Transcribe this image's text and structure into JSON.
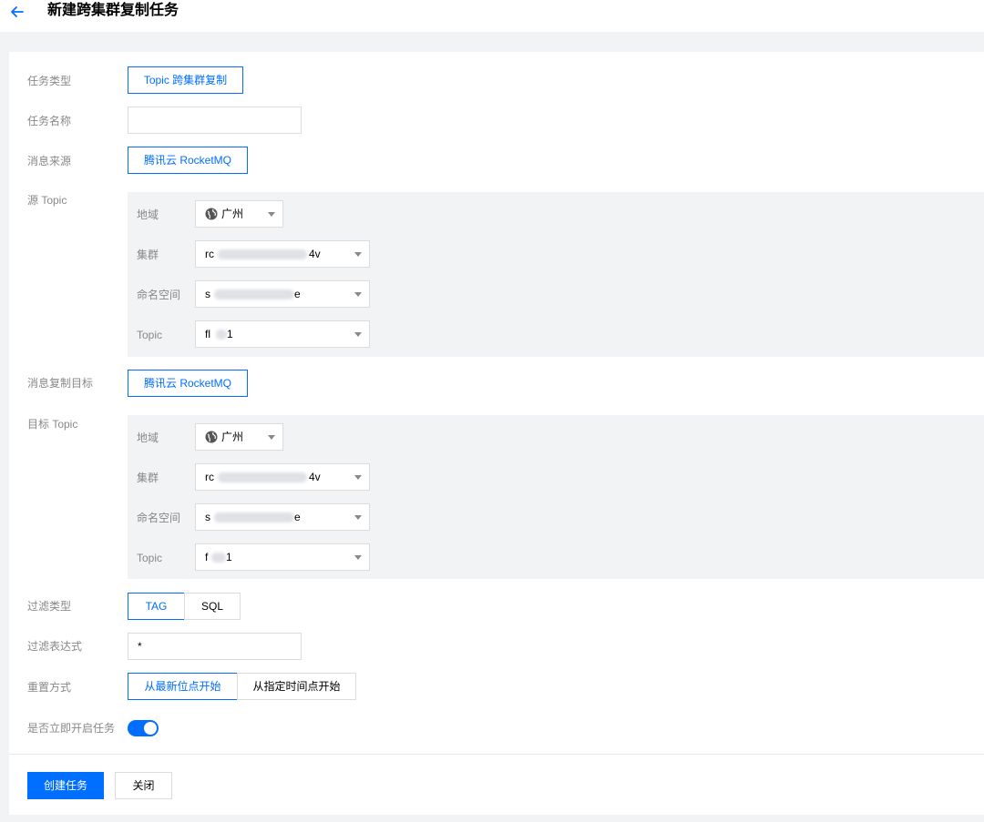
{
  "header": {
    "back_icon": "arrow-left-icon",
    "title": "新建跨集群复制任务"
  },
  "form": {
    "task_type": {
      "label": "任务类型",
      "value": "Topic 跨集群复制"
    },
    "task_name": {
      "label": "任务名称",
      "value": "",
      "placeholder": ""
    },
    "message_source": {
      "label": "消息来源",
      "value": "腾讯云 RocketMQ"
    },
    "source_topic": {
      "label": "源 Topic",
      "region": {
        "label": "地域",
        "value": "广州",
        "icon": "globe-icon"
      },
      "cluster": {
        "label": "集群",
        "value_prefix": "rc",
        "value_suffix": "4v"
      },
      "namespace": {
        "label": "命名空间",
        "value_prefix": "s",
        "value_suffix": "e"
      },
      "topic": {
        "label": "Topic",
        "value_prefix": "fl",
        "value_suffix": "1"
      }
    },
    "message_target": {
      "label": "消息复制目标",
      "value": "腾讯云 RocketMQ"
    },
    "target_topic": {
      "label": "目标 Topic",
      "region": {
        "label": "地域",
        "value": "广州",
        "icon": "globe-icon"
      },
      "cluster": {
        "label": "集群",
        "value_prefix": "rc",
        "value_suffix": "4v"
      },
      "namespace": {
        "label": "命名空间",
        "value_prefix": "s",
        "value_suffix": "e"
      },
      "topic": {
        "label": "Topic",
        "value_prefix": "f",
        "value_suffix": "1"
      }
    },
    "filter_type": {
      "label": "过滤类型",
      "options": [
        "TAG",
        "SQL"
      ],
      "selected": "TAG"
    },
    "filter_expression": {
      "label": "过滤表达式",
      "value": "*"
    },
    "reset_method": {
      "label": "重置方式",
      "options": [
        "从最新位点开始",
        "从指定时间点开始"
      ],
      "selected": "从最新位点开始"
    },
    "start_now": {
      "label": "是否立即开启任务",
      "enabled": true
    }
  },
  "footer": {
    "create_label": "创建任务",
    "close_label": "关闭"
  },
  "colors": {
    "accent": "#006eff",
    "page_bg": "#f2f3f5",
    "label": "#888888",
    "border": "#dcdcdc"
  }
}
